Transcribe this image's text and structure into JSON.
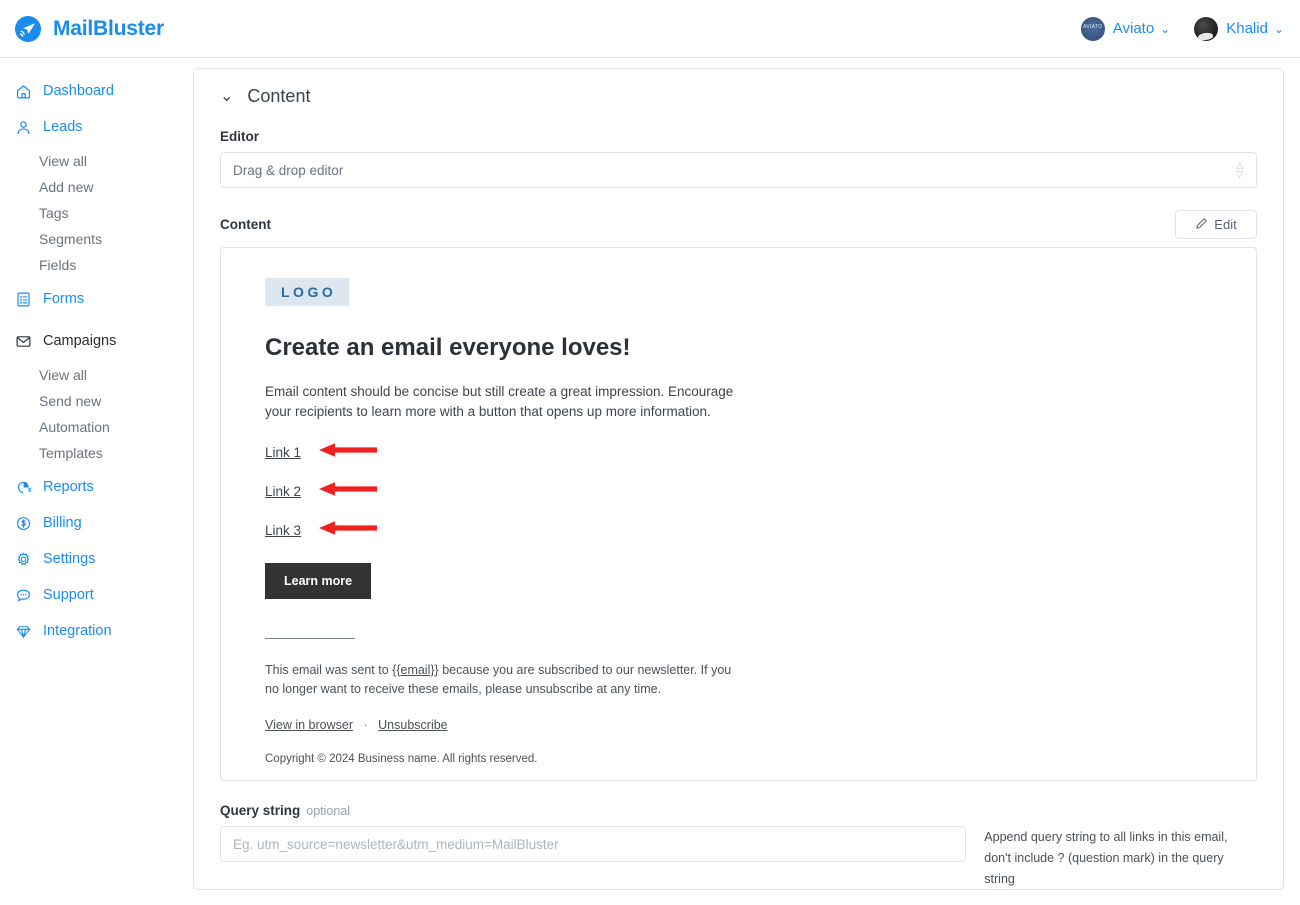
{
  "header": {
    "brand": "MailBluster",
    "brand_icon": "paper-plane-icon",
    "accounts": [
      {
        "name": "Aviato",
        "avatar": "aviato-avatar",
        "caret": "⌄"
      },
      {
        "name": "Khalid",
        "avatar": "khalid-avatar",
        "caret": "⌄"
      }
    ]
  },
  "sidebar": {
    "items": [
      {
        "label": "Dashboard",
        "icon": "home-icon",
        "active": false,
        "children": []
      },
      {
        "label": "Leads",
        "icon": "user-icon",
        "active": false,
        "children": [
          "View all",
          "Add new",
          "Tags",
          "Segments",
          "Fields"
        ]
      },
      {
        "label": "Forms",
        "icon": "form-icon",
        "active": false,
        "children": []
      },
      {
        "label": "Campaigns",
        "icon": "envelope-icon",
        "active": true,
        "children": [
          "View all",
          "Send new",
          "Automation",
          "Templates"
        ]
      },
      {
        "label": "Reports",
        "icon": "pie-chart-icon",
        "active": false,
        "children": []
      },
      {
        "label": "Billing",
        "icon": "dollar-circle-icon",
        "active": false,
        "children": []
      },
      {
        "label": "Settings",
        "icon": "gear-icon",
        "active": false,
        "children": []
      },
      {
        "label": "Support",
        "icon": "chat-icon",
        "active": false,
        "children": []
      },
      {
        "label": "Integration",
        "icon": "diamond-icon",
        "active": false,
        "children": []
      }
    ]
  },
  "main": {
    "section_title": "Content",
    "collapse_caret": "⌄",
    "editor": {
      "label": "Editor",
      "value": "Drag & drop editor"
    },
    "content": {
      "label": "Content",
      "edit_button": "Edit",
      "edit_icon": "pencil-icon"
    },
    "email": {
      "logo_text": "LOGO",
      "heading": "Create an email everyone loves!",
      "paragraph": "Email content should be concise but still create a great impression. Encourage your recipients to learn more with a button that opens up more information.",
      "links": [
        "Link 1",
        "Link 2",
        "Link 3"
      ],
      "cta_button": "Learn more",
      "footer_text_before": "This email was sent to ",
      "footer_merge_tag": "{{email}}",
      "footer_text_after": " because you are subscribed to our newsletter. If you no longer want to receive these emails, please unsubscribe at any time.",
      "footer_links": [
        "View in browser",
        "Unsubscribe"
      ],
      "footer_link_separator": "·",
      "copyright": "Copyright © 2024 Business name. All rights reserved."
    },
    "query_string": {
      "label": "Query string",
      "optional": "optional",
      "placeholder": "Eg. utm_source=newsletter&utm_medium=MailBluster",
      "value": "",
      "help_line_1": "Append query string to all links in this email,",
      "help_line_2": "don't include ? (question mark) in the query string"
    },
    "annotations": {
      "arrow_color": "#ef2121",
      "arrow_count": 3,
      "arrow_direction": "left"
    }
  },
  "colors": {
    "brand_blue": "#1a8cf0",
    "nav_link": "#1a8cf0",
    "nav_sub": "#6b7280",
    "panel_border": "#dfe3ea",
    "cta_dark": "#333333",
    "logo_badge_bg": "#dce7ef",
    "logo_badge_fg": "#2b6b9e",
    "arrow_red": "#ef2121"
  }
}
